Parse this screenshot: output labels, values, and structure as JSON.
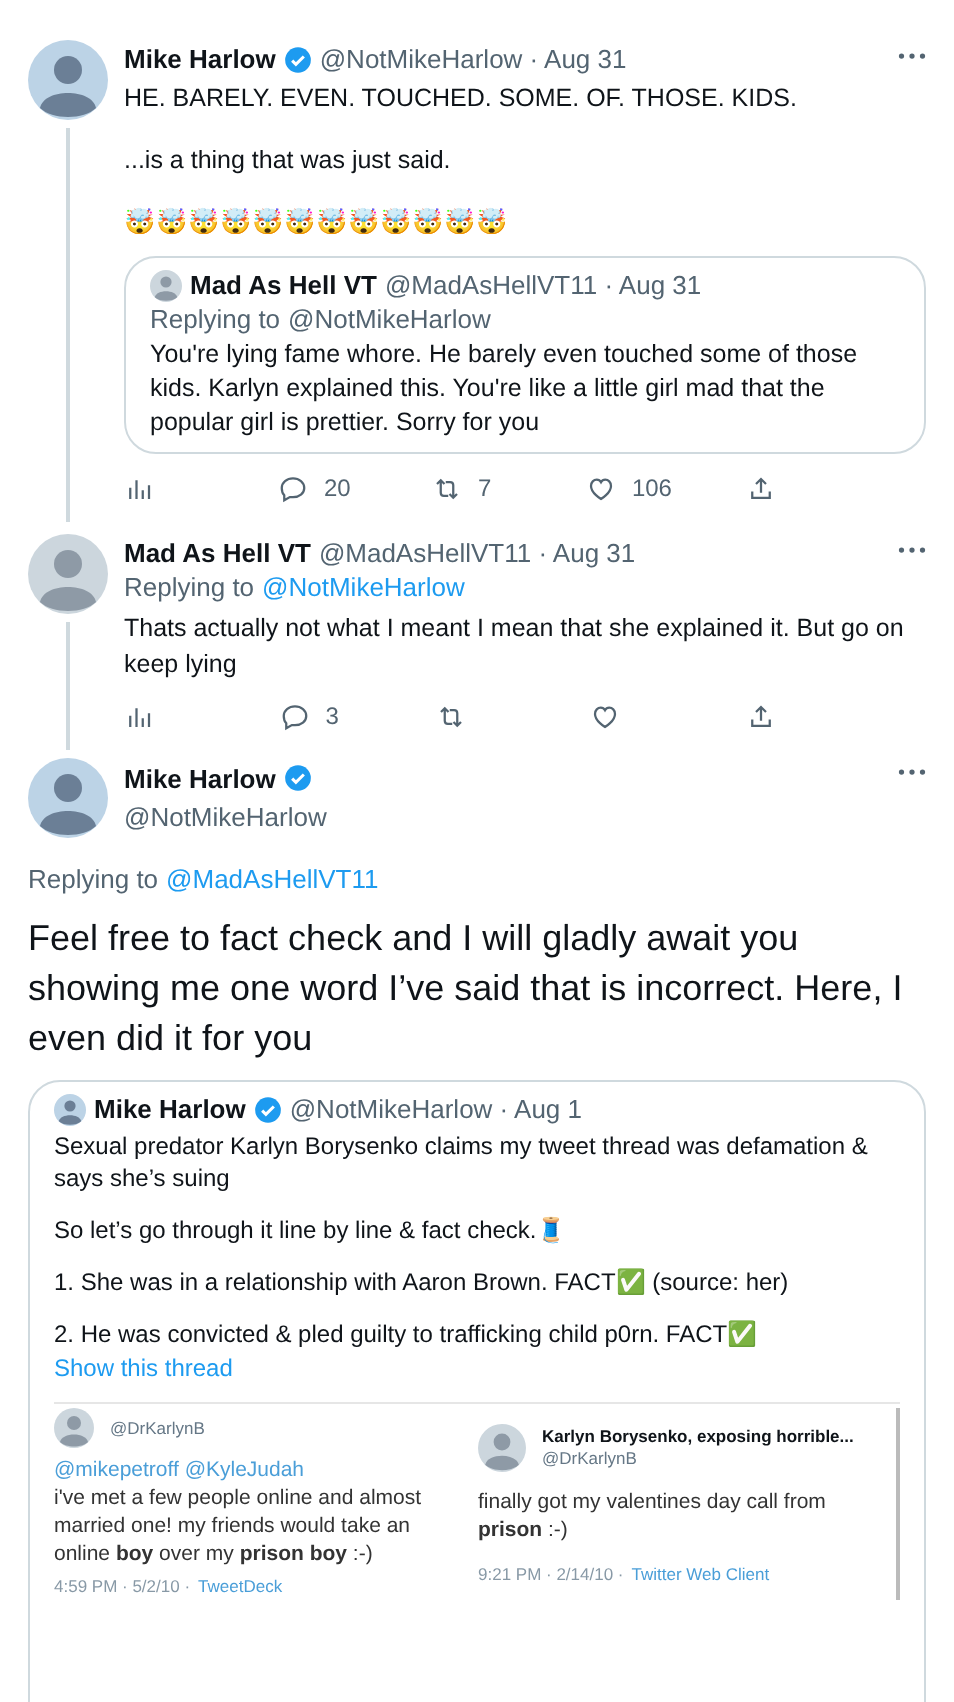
{
  "thread": [
    {
      "name": "Mike Harlow",
      "verified": true,
      "handle_time": "@NotMikeHarlow · Aug 31",
      "paragraphs": [
        "HE. BARELY. EVEN. TOUCHED. SOME. OF. THOSE. KIDS.",
        "...is a thing that was just said.",
        "🤯🤯🤯🤯🤯🤯🤯🤯🤯🤯🤯🤯"
      ],
      "quote": {
        "name": "Mad As Hell VT",
        "verified": false,
        "handle_time": "@MadAsHellVT11 · Aug 31",
        "replying_label": "Replying to",
        "replying_to": "@NotMikeHarlow",
        "paragraphs": [
          "You're lying fame whore. He barely even touched some of those kids. Karlyn explained this. You're like a little girl mad that the popular girl is prettier. Sorry for you"
        ]
      },
      "actions": [
        {
          "kind": "views"
        },
        {
          "kind": "reply",
          "count": "20"
        },
        {
          "kind": "retweet",
          "count": "7"
        },
        {
          "kind": "like",
          "count": "106"
        },
        {
          "kind": "share"
        }
      ]
    },
    {
      "name": "Mad As Hell VT",
      "verified": false,
      "handle_time": "@MadAsHellVT11 · Aug 31",
      "replying_label": "Replying to",
      "replying_to": "@NotMikeHarlow",
      "paragraphs": [
        "Thats actually not what I meant I mean that she explained it. But go on keep lying"
      ],
      "actions": [
        {
          "kind": "views"
        },
        {
          "kind": "reply",
          "count": "3"
        },
        {
          "kind": "retweet"
        },
        {
          "kind": "like"
        },
        {
          "kind": "share"
        }
      ]
    }
  ],
  "focused": {
    "name": "Mike Harlow",
    "verified": true,
    "handle": "@NotMikeHarlow",
    "replying_label": "Replying to",
    "replying_to": "@MadAsHellVT11",
    "text": "Feel free to fact check and I will gladly await you showing me one word I’ve said that is incorrect. Here, I even did it for you",
    "quote": {
      "name": "Mike Harlow",
      "verified": true,
      "handle_time": "@NotMikeHarlow · Aug 1",
      "paragraphs": [
        "Sexual predator Karlyn Borysenko claims my tweet thread was defamation & says she’s suing",
        "So let’s go through it line by line & fact check.🧵",
        "1. She was in a relationship with Aaron Brown. FACT✅ (source: her)",
        "2. He was convicted & pled guilty to trafficking child p0rn. FACT✅"
      ],
      "show_thread": "Show this thread",
      "image": [
        {
          "handle": "@DrKarlynB",
          "mentions": "@mikepetroff @KyleJudah",
          "text": "i've met a few people online and almost married one! my friends would take an online **boy** over my **prison boy** :-)",
          "meta": "4:59 PM · 5/2/10 ·",
          "client": "TweetDeck"
        },
        {
          "name": "Karlyn Borysenko, exposing horrible...",
          "handle": "@DrKarlynB",
          "text": "finally got my valentines day call from **prison** :-)",
          "meta": "9:21 PM · 2/14/10 ·",
          "client": "Twitter Web Client"
        }
      ]
    }
  }
}
